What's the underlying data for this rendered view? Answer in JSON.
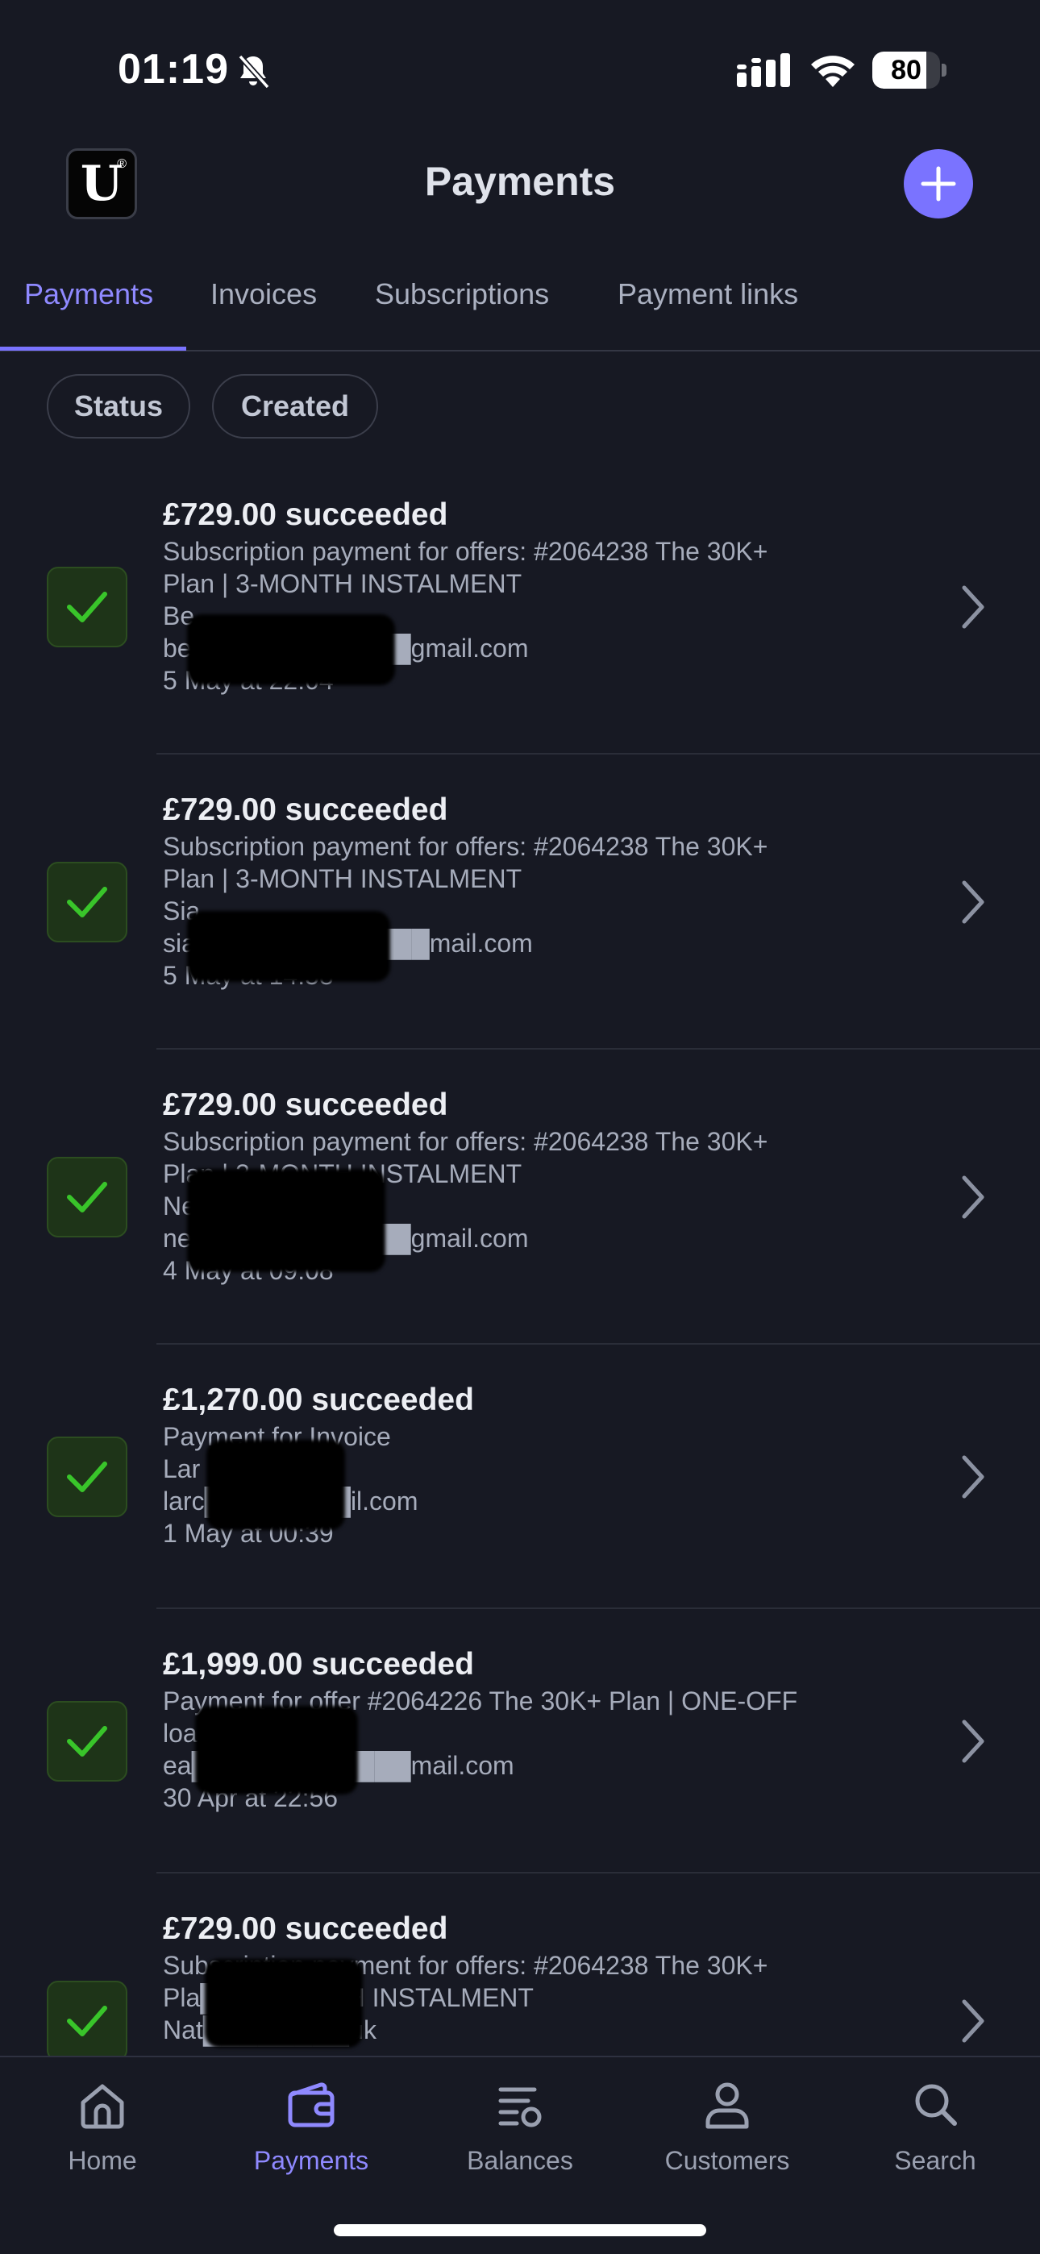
{
  "status_bar": {
    "time": "01:19",
    "battery_level": "80",
    "battery_fraction": 0.8,
    "icons": [
      "bell-muted-icon",
      "signal-icon",
      "wifi-icon",
      "battery-icon"
    ]
  },
  "header": {
    "logo_letter": "U",
    "logo_mark": "®",
    "title": "Payments",
    "add_icon": "plus-icon"
  },
  "tabs": [
    {
      "label": "Payments",
      "active": true
    },
    {
      "label": "Invoices",
      "active": false
    },
    {
      "label": "Subscriptions",
      "active": false
    },
    {
      "label": "Payment links",
      "active": false
    }
  ],
  "filters": [
    {
      "label": "Status"
    },
    {
      "label": "Created"
    }
  ],
  "payments": [
    {
      "title": "£729.00 succeeded",
      "description_lines": [
        "Subscription payment for offers: #2064238 The 30K+",
        "Plan | 3-MONTH INSTALMENT"
      ],
      "name": "Be",
      "email": "be████████████gmail.com",
      "date": "5 May at 22:04",
      "status_icon": "check-icon"
    },
    {
      "title": "£729.00 succeeded",
      "description_lines": [
        "Subscription payment for offers: #2064238 The 30K+",
        "Plan | 3-MONTH INSTALMENT"
      ],
      "name": "Sia",
      "email": "siag████████████mail.com",
      "date": "5 May at 14:58",
      "status_icon": "check-icon"
    },
    {
      "title": "£729.00 succeeded",
      "description_lines": [
        "Subscription payment for offers: #2064238 The 30K+",
        "Plan | 3-MONTH INSTALMENT"
      ],
      "name": "Ne",
      "email": "ne████████████gmail.com",
      "date": "4 May at 09:08",
      "status_icon": "check-icon"
    },
    {
      "title": "£1,270.00 succeeded",
      "description_lines": [
        "Payment for Invoice"
      ],
      "name": "Lar",
      "email": "larc████████il.com",
      "date": "1 May at 00:39",
      "status_icon": "check-icon"
    },
    {
      "title": "£1,999.00 succeeded",
      "description_lines": [
        "Payment for offer #2064226 The 30K+ Plan | ONE-OFF"
      ],
      "name": "loa",
      "email": "ea████████████mail.com",
      "date": "30 Apr at 22:56",
      "status_icon": "check-icon"
    },
    {
      "title": "£729.00 succeeded",
      "description_lines": [
        "Subscription payment for offers: #2064238 The 30K+",
        "Pla████████H INSTALMENT"
      ],
      "name": "Nat████████uk",
      "email": "",
      "date": "",
      "status_icon": "check-icon"
    }
  ],
  "bottom_nav": [
    {
      "label": "Home",
      "icon": "home-icon",
      "active": false
    },
    {
      "label": "Payments",
      "icon": "wallet-icon",
      "active": true
    },
    {
      "label": "Balances",
      "icon": "balances-icon",
      "active": false
    },
    {
      "label": "Customers",
      "icon": "person-icon",
      "active": false
    },
    {
      "label": "Search",
      "icon": "search-icon",
      "active": false
    }
  ],
  "colors": {
    "background": "#171923",
    "accent": "#7a73ff",
    "success_green": "#39c52a",
    "success_bg": "#1e3418",
    "muted_text": "#a6acbb"
  }
}
